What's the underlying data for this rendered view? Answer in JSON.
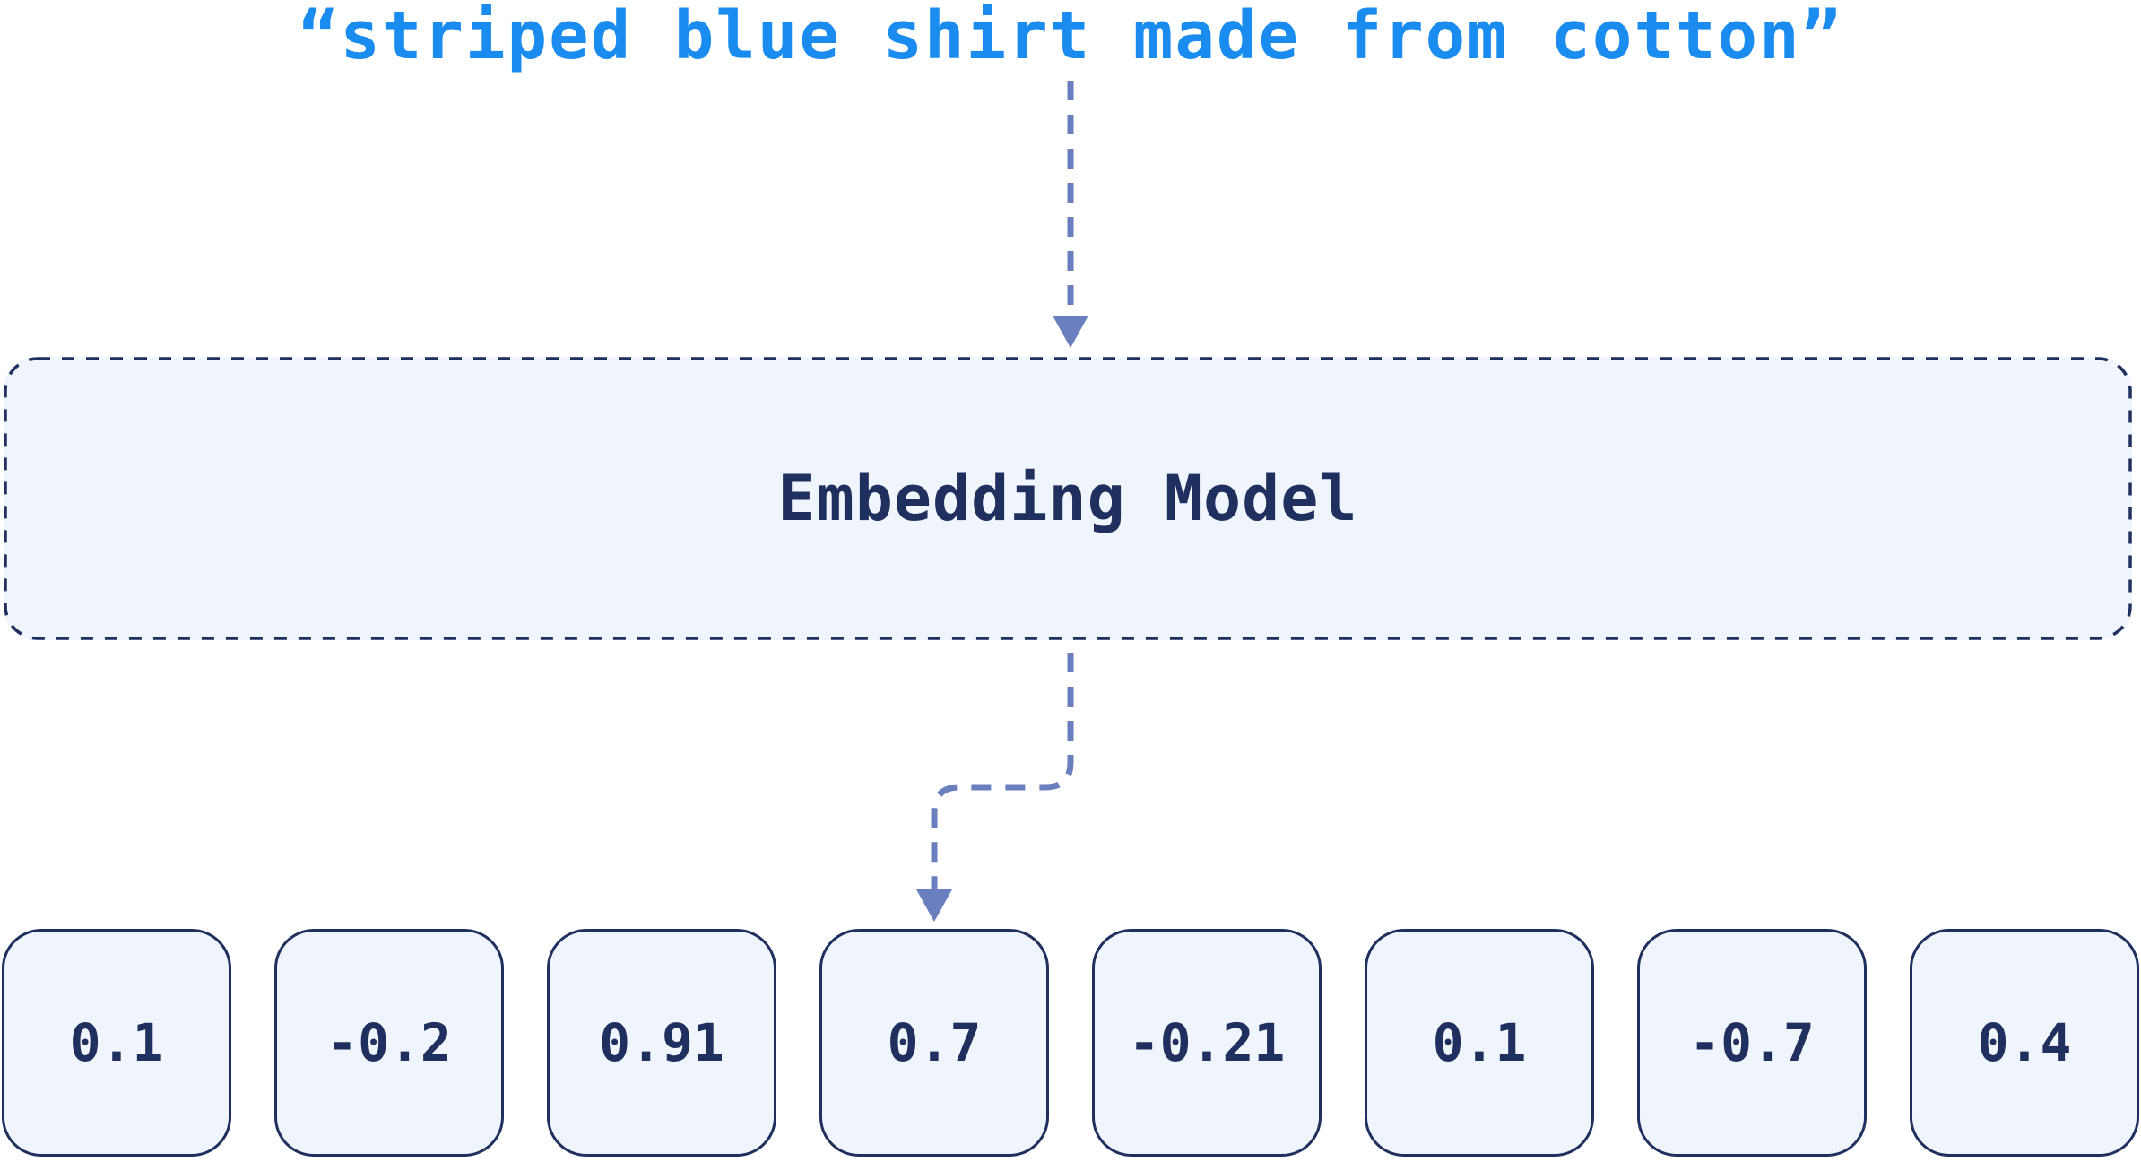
{
  "query": {
    "text": "“striped blue shirt made from cotton”"
  },
  "model": {
    "label": "Embedding Model"
  },
  "vector": {
    "values": [
      "0.1",
      "-0.2",
      "0.91",
      "0.7",
      "-0.21",
      "0.1",
      "-0.7",
      "0.4"
    ]
  },
  "colors": {
    "query_text": "#1a8cef",
    "arrow": "#6a7fbd",
    "box_border": "#1f2f5e",
    "box_fill": "#f0f5fd",
    "label_text": "#1f2f5e"
  }
}
